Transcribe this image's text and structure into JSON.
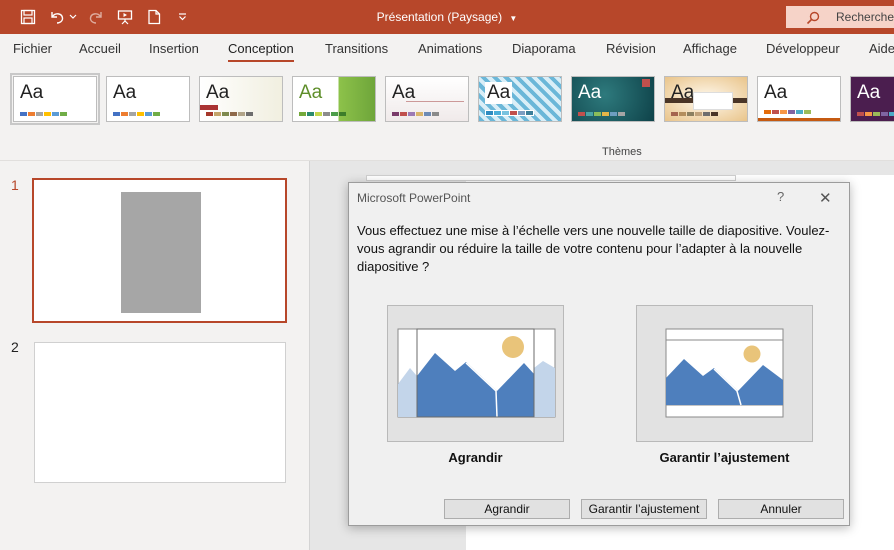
{
  "titlebar": {
    "document_title": "Présentation (Paysage)",
    "search_label": "Rechercher"
  },
  "menu": {
    "tabs": [
      "Fichier",
      "Accueil",
      "Insertion",
      "Conception",
      "Transitions",
      "Animations",
      "Diaporama",
      "Révision",
      "Affichage",
      "Développeur",
      "Aide"
    ],
    "active_tab": "Conception"
  },
  "ribbon": {
    "themes_group_label": "Thèmes",
    "theme_tiles": [
      "Aa",
      "Aa",
      "Aa",
      "Aa",
      "Aa",
      "Aa",
      "Aa",
      "Aa",
      "Aa",
      "Aa"
    ]
  },
  "slides": {
    "numbers": [
      "1",
      "2"
    ]
  },
  "dialog": {
    "title": "Microsoft PowerPoint",
    "help": "?",
    "close": "✕",
    "message": "Vous effectuez une mise à l’échelle vers une nouvelle taille de diapositive. Voulez-vous agrandir ou réduire la taille de votre contenu pour l’adapter à la nouvelle diapositive ?",
    "option_maximize_label": "Agrandir",
    "option_fit_label": "Garantir l’ajustement",
    "buttons": {
      "maximize": "Agrandir",
      "fit": "Garantir l’ajustement",
      "cancel": "Annuler"
    }
  },
  "colors": {
    "accent": "#b7472a",
    "image_blue": "#4e7fbd",
    "image_light_blue": "#c3d5ea",
    "sun": "#e9c47a"
  }
}
